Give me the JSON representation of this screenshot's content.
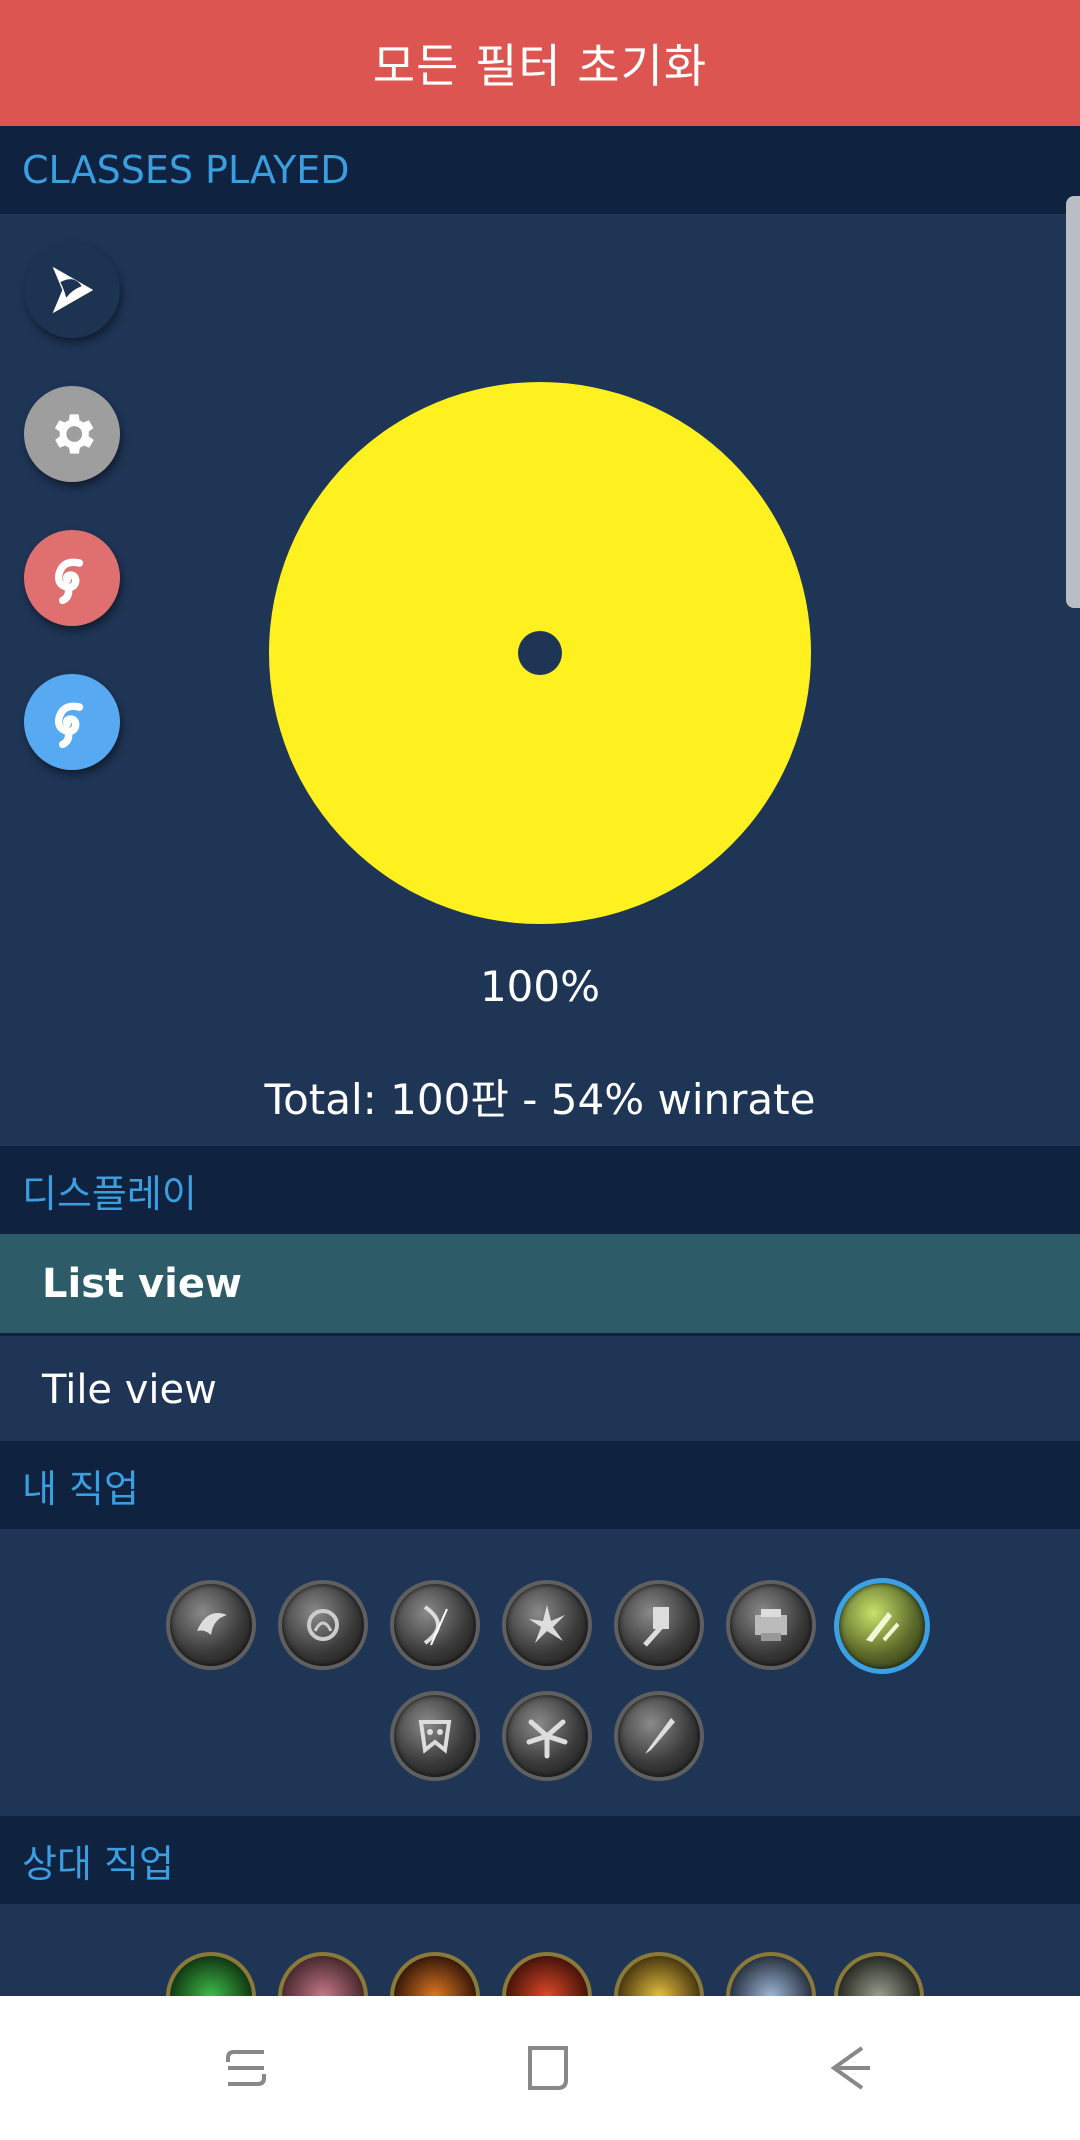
{
  "header": {
    "reset_filters_label": "모든 필터 초기화"
  },
  "sections": {
    "classes_played": "CLASSES PLAYED",
    "display": "디스플레이",
    "my_class": "내 직업",
    "opponent_class": "상대 직업"
  },
  "chart_data": {
    "type": "pie",
    "slices": [
      {
        "value": 100,
        "color": "#fff01f"
      }
    ],
    "percent_label": "100%",
    "total_label": "Total: 100판 - 54% winrate"
  },
  "side_buttons": [
    {
      "icon": "game-mode-icon",
      "color": "#1d3352"
    },
    {
      "icon": "gear-icon",
      "color": "#9e9e9e"
    },
    {
      "icon": "hearthstone-ranked-icon",
      "color": "#e07070"
    },
    {
      "icon": "hearthstone-casual-icon",
      "color": "#57aaf2"
    }
  ],
  "display_options": {
    "list_view": "List view",
    "tile_view": "Tile view",
    "selected": "List view"
  },
  "my_classes": [
    {
      "icon": "demon-hunter-icon",
      "selected": false
    },
    {
      "icon": "druid-icon",
      "selected": false
    },
    {
      "icon": "hunter-icon",
      "selected": false
    },
    {
      "icon": "mage-icon",
      "selected": false
    },
    {
      "icon": "paladin-icon",
      "selected": false
    },
    {
      "icon": "priest-icon",
      "selected": false
    },
    {
      "icon": "rogue-icon",
      "selected": true
    },
    {
      "icon": "shaman-icon",
      "selected": false
    },
    {
      "icon": "warlock-icon",
      "selected": false
    },
    {
      "icon": "warrior-icon",
      "selected": false
    }
  ],
  "opponent_classes": [
    {
      "icon": "demon-hunter-icon",
      "color": "#3fbf4a"
    },
    {
      "icon": "druid-icon",
      "color": "#c87a8a"
    },
    {
      "icon": "hunter-icon",
      "color": "#e07a20"
    },
    {
      "icon": "mage-icon",
      "color": "#e04a2a"
    },
    {
      "icon": "paladin-icon",
      "color": "#e8c040"
    },
    {
      "icon": "priest-icon",
      "color": "#a0b8d8"
    },
    {
      "icon": "rogue-icon",
      "color": "#9aa090"
    }
  ],
  "nav": {
    "recent_apps": "recent-apps-icon",
    "home": "home-icon",
    "back": "back-icon"
  }
}
